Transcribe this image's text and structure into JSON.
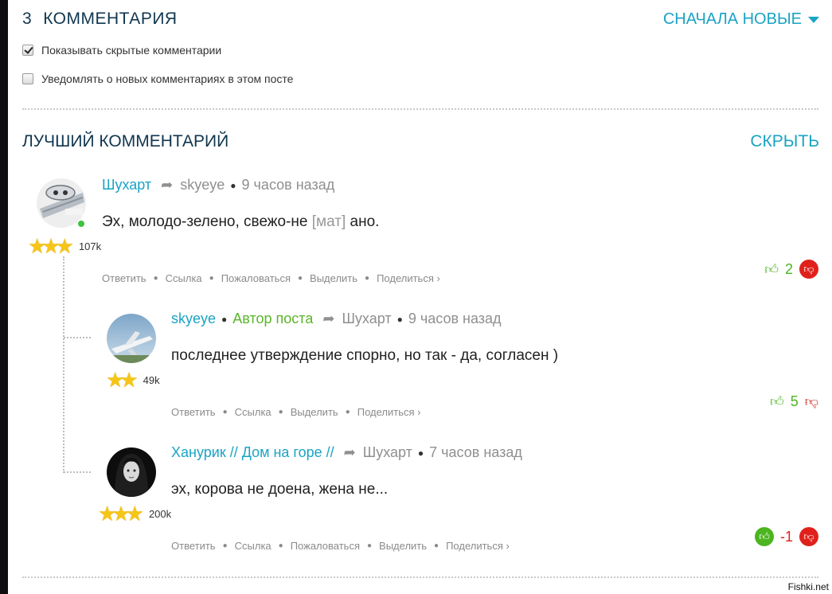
{
  "header": {
    "count": "3",
    "title": "КОММЕНТАРИЯ",
    "sort_label": "СНАЧАЛА НОВЫЕ"
  },
  "options": [
    {
      "label": "Показывать скрытые комментарии",
      "checked": true
    },
    {
      "label": "Уведомлять о новых комментариях в этом посте",
      "checked": false
    }
  ],
  "best": {
    "title": "ЛУЧШИЙ КОММЕНТАРИЙ",
    "hide_label": "СКРЫТЬ"
  },
  "comments": [
    {
      "author": "Шухарт",
      "reply_to": "skyeye",
      "time": "9 часов назад",
      "text_before": "Эх, молодо-зелено, свежо-не ",
      "text_censored": "[мат]",
      "text_after": " ано.",
      "rating": "107k",
      "stars": 3,
      "score": "2",
      "actions": [
        "Ответить",
        "Ссылка",
        "Пожаловаться",
        "Выделить",
        "Поделиться ›"
      ]
    },
    {
      "author": "skyeye",
      "badge": "Автор поста",
      "reply_to": "Шухарт",
      "time": "9 часов назад",
      "text": "последнее утверждение спорно, но так - да, согласен )",
      "rating": "49k",
      "stars": 2,
      "score": "5",
      "actions": [
        "Ответить",
        "Ссылка",
        "Выделить",
        "Поделиться ›"
      ]
    },
    {
      "author": "Ханурик // Дом на горе //",
      "reply_to": "Шухарт",
      "time": "7 часов назад",
      "text": "эх, корова не доена, жена не...",
      "rating": "200k",
      "stars": 3,
      "score": "-1",
      "actions": [
        "Ответить",
        "Ссылка",
        "Пожаловаться",
        "Выделить",
        "Поделиться ›"
      ]
    }
  ],
  "watermark": "Fishki.net",
  "colors": {
    "link": "#1aa3c4",
    "heading": "#10364f",
    "positive": "#4cb520",
    "negative": "#e0211b",
    "star": "#f5c518"
  },
  "icons": {
    "reply": "share-arrow-icon",
    "up": "thumbs-up-icon",
    "down": "thumbs-down-icon",
    "rank": "star-icon"
  }
}
